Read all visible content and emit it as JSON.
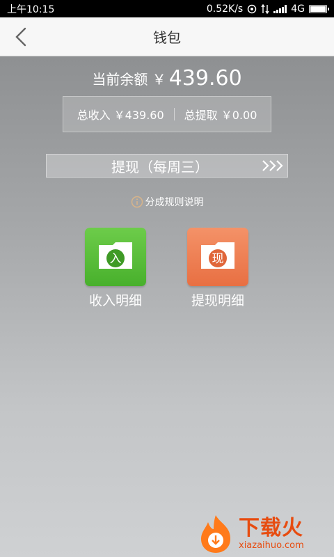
{
  "status_bar": {
    "time": "上午10:15",
    "net_speed": "0.52K/s",
    "network_type": "4G",
    "icons": [
      "hotspot-icon",
      "data-arrows-icon",
      "signal-icon",
      "battery-icon"
    ]
  },
  "nav": {
    "back_icon": "chevron-left-icon",
    "title": "钱包"
  },
  "balance": {
    "label": "当前余额 ￥",
    "value": "439.60"
  },
  "summary": {
    "total_income": "总收入 ￥439.60",
    "total_withdrawn": "总提取 ￥0.00"
  },
  "withdraw": {
    "label": "提现（每周三）",
    "arrow_icon": "triple-chevron-right-icon"
  },
  "rules": {
    "label": "分成规则说明",
    "icon": "info-icon"
  },
  "tiles": {
    "income": {
      "label": "收入明细",
      "glyph": "入",
      "color": "#52b934"
    },
    "withdrawal": {
      "label": "提现明细",
      "glyph": "现",
      "color": "#ec7a4c"
    }
  },
  "watermark": {
    "name": "下载火",
    "url": "xiazaihuo.com",
    "color": "#e74c10"
  }
}
